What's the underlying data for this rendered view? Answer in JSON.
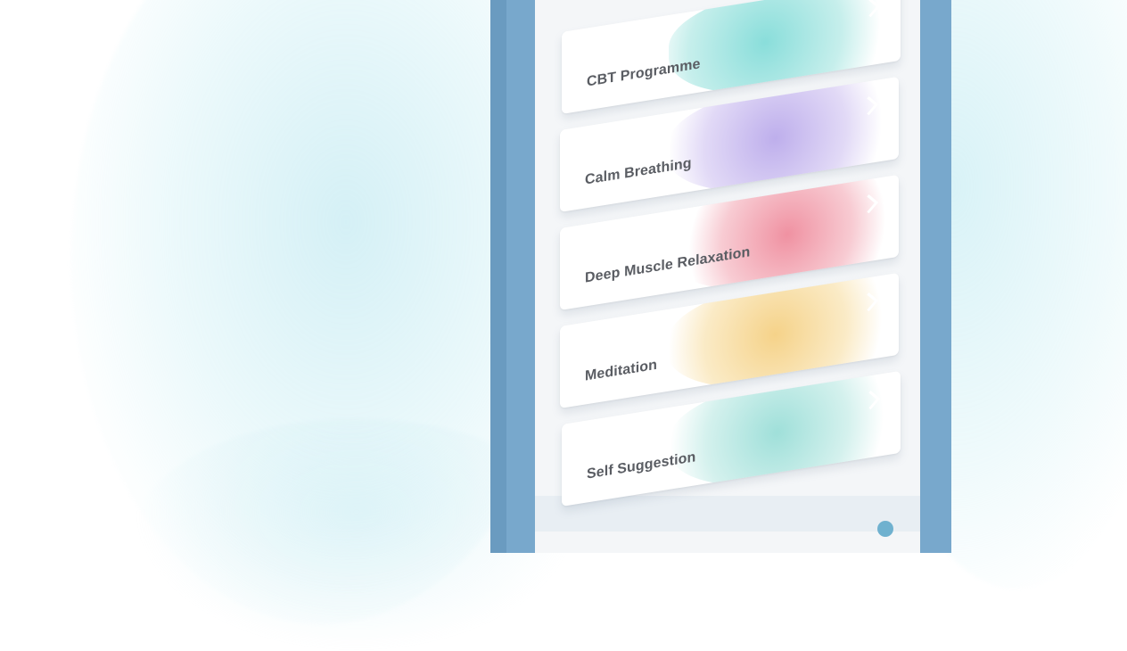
{
  "programmes": [
    {
      "label": "CBT  Programme",
      "color": "#7fd6d4"
    },
    {
      "label": "Calm Breathing",
      "color": "#b9a4e3"
    },
    {
      "label": "Deep Muscle Relaxation",
      "color": "#ee8d9d"
    },
    {
      "label": "Meditation",
      "color": "#f3cf86"
    },
    {
      "label": "Self Suggestion",
      "color": "#8fd8d0"
    }
  ],
  "icons": {
    "chevron": "chevron-right-icon"
  },
  "colors": {
    "phone_frame": "#78a8cc",
    "screen_background": "#f4f6f8",
    "label_text": "#5a5d63"
  }
}
